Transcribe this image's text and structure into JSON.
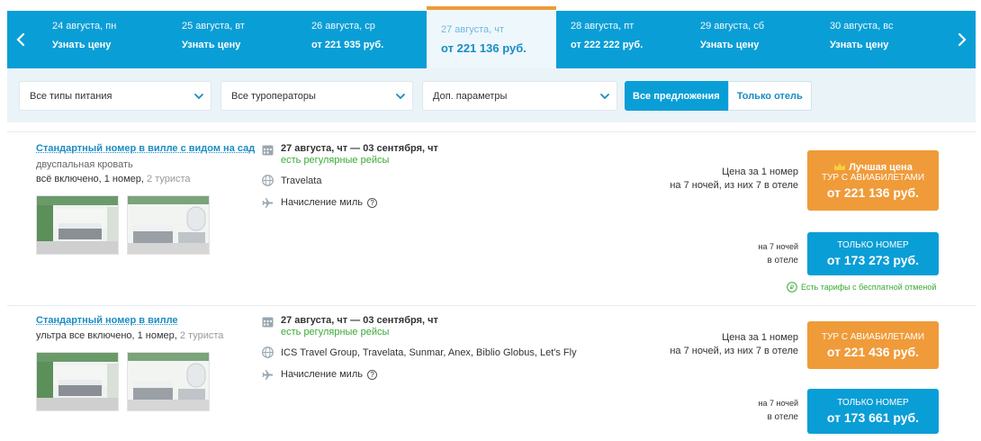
{
  "date_bar": {
    "days": [
      {
        "date": "24 августа, пн",
        "price": "Узнать цену"
      },
      {
        "date": "25 августа, вт",
        "price": "Узнать цену"
      },
      {
        "date": "26 августа, ср",
        "price": "от 221 935 руб."
      },
      {
        "date": "27 августа, чт",
        "price": "от 221 136 руб."
      },
      {
        "date": "28 августа, пт",
        "price": "от 222 222 руб."
      },
      {
        "date": "29 августа, сб",
        "price": "Узнать цену"
      },
      {
        "date": "30 августа, вс",
        "price": "Узнать цену"
      }
    ],
    "selected": "27 августа, чт"
  },
  "filters": {
    "meal": "Все типы питания",
    "operators": "Все туроператоры",
    "extra": "Доп. параметры",
    "toggle_all": "Все предложения",
    "toggle_hotel": "Только отель"
  },
  "offers": [
    {
      "title": "Стандартный номер в вилле с видом на сад",
      "bed": "двуспальная кровать",
      "meta_main": "всё включено, 1 номер,",
      "meta_muted": "2 туриста",
      "dates": "27 августа, чт — 03 сентября, чт",
      "flights": "есть регулярные рейсы",
      "operators": "Travelata",
      "miles": "Начисление миль",
      "tour_label_1": "Цена за 1 номер",
      "tour_label_2": "на 7 ночей, из них 7 в отеле",
      "tour_badge": "Лучшая цена",
      "tour_caption": "ТУР С АВИАБИЛЕТАМИ",
      "tour_price": "от 221 136 руб.",
      "room_label_1": "на 7 ночей",
      "room_label_2": "в отеле",
      "room_caption": "ТОЛЬКО НОМЕР",
      "room_price": "от 173 273 руб.",
      "free_cancel": "Есть тарифы с бесплатной отменой"
    },
    {
      "title": "Стандартный номер в вилле",
      "meta_main": "ультра все включено, 1 номер,",
      "meta_muted": "2 туриста",
      "dates": "27 августа, чт — 03 сентября, чт",
      "flights": "есть регулярные рейсы",
      "operators": "ICS Travel Group, Travelata, Sunmar, Anex, Biblio Globus, Let's Fly",
      "miles": "Начисление миль",
      "tour_label_1": "Цена за 1 номер",
      "tour_label_2": "на 7 ночей, из них 7 в отеле",
      "tour_caption": "ТУР С АВИАБИЛЕТАМИ",
      "tour_price": "от 221 436 руб.",
      "room_label_1": "на 7 ночей",
      "room_label_2": "в отеле",
      "room_caption": "ТОЛЬКО НОМЕР",
      "room_price": "от 173 661 руб."
    }
  ],
  "colors": {
    "primary": "#0a9ed6",
    "accent": "#ef9b3a",
    "green": "#3aaa35",
    "link": "#1a8cc4"
  }
}
